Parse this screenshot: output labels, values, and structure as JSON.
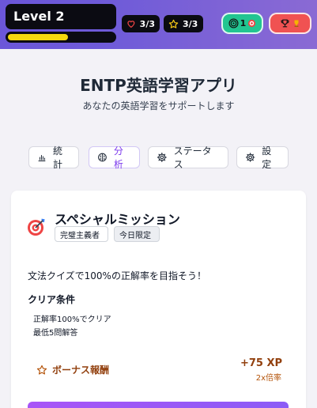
{
  "header": {
    "level_label": "Level 2",
    "xp_progress": 0.57,
    "hearts": "3/3",
    "stars": "3/3",
    "target_badge": "1",
    "colors": {
      "xp_bar": "#f5d80f",
      "target_button": "#22c591",
      "trophy_button": "#f05252"
    }
  },
  "app": {
    "title": "ENTP英語学習アプリ",
    "subtitle": "あなたの英語学習をサポートします"
  },
  "tabs": [
    {
      "label": "統計",
      "icon": "bar-chart-icon",
      "active": false
    },
    {
      "label": "分析",
      "icon": "brain-icon",
      "active": true
    },
    {
      "label": "ステータス",
      "icon": "gear-icon",
      "active": false
    },
    {
      "label": "設定",
      "icon": "gear-icon",
      "active": false
    }
  ],
  "mission": {
    "title": "スペシャルミッション",
    "tags": [
      "完璧主義者",
      "今日限定"
    ],
    "description": "文法クイズで100%の正解率を目指そう！",
    "conditions_heading": "クリア条件",
    "conditions": [
      "正解率100%でクリア",
      "最低5問解答"
    ],
    "bonus_label": "ボーナス報酬",
    "bonus_xp": "+75 XP",
    "bonus_multiplier": "2x倍率"
  }
}
